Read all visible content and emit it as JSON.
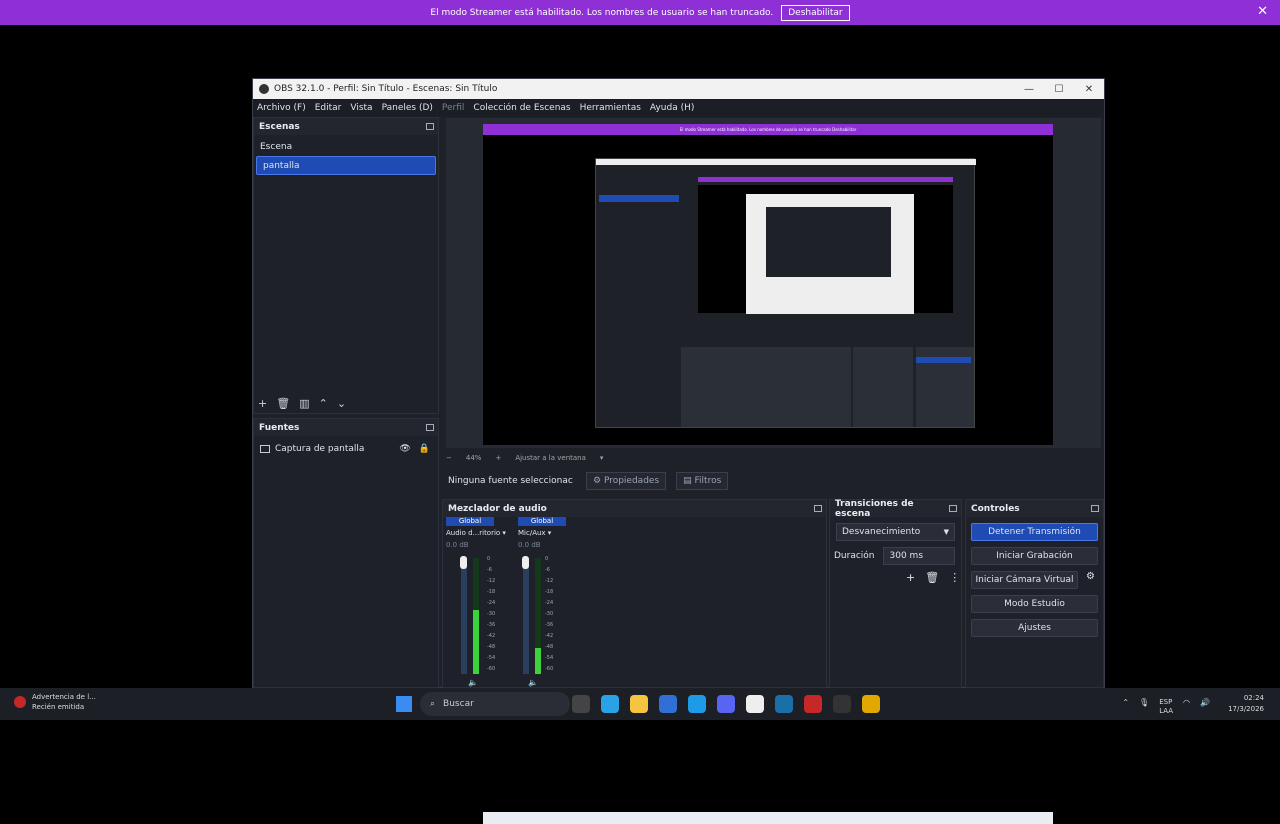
{
  "banner": {
    "message": "El modo Streamer está habilitado. Los nombres de usuario se han truncado.",
    "button": "Deshabilitar",
    "close": "✕"
  },
  "window": {
    "title": "OBS 32.1.0 - Perfil: Sin Título - Escenas: Sin Título",
    "controls": [
      "—",
      "☐",
      "✕"
    ]
  },
  "menu": [
    "Archivo (F)",
    "Editar",
    "Vista",
    "Paneles (D)",
    "Perfil",
    "Colección de Escenas",
    "Herramientas",
    "Ayuda (H)"
  ],
  "scenes": {
    "title": "Escenas",
    "items": [
      "Escena",
      "pantalla"
    ],
    "selected": 1
  },
  "sources": {
    "title": "Fuentes",
    "items": [
      "Captura de pantalla"
    ]
  },
  "preview": {
    "zoom": "44%",
    "fit": "Ajustar a la ventana",
    "banner": "El modo Streamer está habilitado. Los nombres de usuario se han truncado  Deshabilitar"
  },
  "propbar": {
    "none": "Ninguna fuente seleccionac",
    "properties": "Propiedades",
    "filters": "Filtros"
  },
  "mixer": {
    "title": "Mezclador de audio",
    "channels": [
      {
        "tag": "Global",
        "name": "Audio d...ritorio",
        "db": "0.0 dB",
        "level": 0.55
      },
      {
        "tag": "Global",
        "name": "Mic/Aux",
        "db": "0.0 dB",
        "level": 0.22
      }
    ],
    "ticks": [
      "0",
      "-6",
      "-12",
      "-18",
      "-24",
      "-30",
      "-36",
      "-42",
      "-48",
      "-54",
      "-60"
    ]
  },
  "transitions": {
    "title": "Transiciones de escena",
    "selected": "Desvanecimiento",
    "duration_label": "Duración",
    "duration_value": "300 ms"
  },
  "controls": {
    "title": "Controles",
    "buttons": [
      "Detener Transmisión",
      "Iniciar Grabación",
      "Iniciar Cámara Virtual",
      "Modo Estudio",
      "Ajustes"
    ]
  },
  "taskbar": {
    "notification_title": "Advertencia de l...",
    "notification_sub": "Recién emitida",
    "search": "Buscar",
    "lang1": "ESP",
    "lang2": "LAA",
    "time": "02:24",
    "date": "17/3/2026",
    "icons": [
      {
        "name": "start",
        "color": "#3b8cf0"
      },
      {
        "name": "taskview",
        "color": "#444"
      },
      {
        "name": "copilot",
        "color": "#29a3e6"
      },
      {
        "name": "explorer",
        "color": "#f5c542"
      },
      {
        "name": "store",
        "color": "#2f6fd6"
      },
      {
        "name": "edge",
        "color": "#1e9be6"
      },
      {
        "name": "discord",
        "color": "#5865f2"
      },
      {
        "name": "github",
        "color": "#eee"
      },
      {
        "name": "steam",
        "color": "#1b6fa8"
      },
      {
        "name": "app-red",
        "color": "#c62828"
      },
      {
        "name": "obs",
        "color": "#333"
      },
      {
        "name": "chrome",
        "color": "#e0a800"
      }
    ]
  }
}
